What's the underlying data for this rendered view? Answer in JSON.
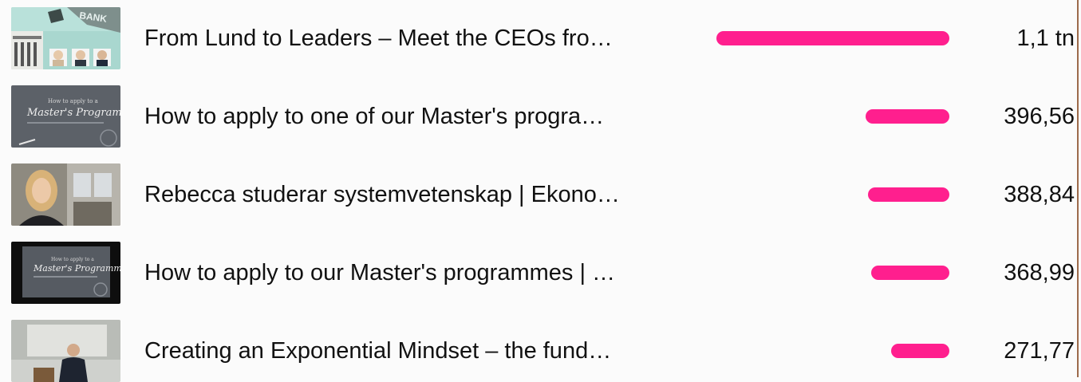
{
  "rows": [
    {
      "title": "From Lund to Leaders – Meet the CEOs fro…",
      "value": "1,1 tn",
      "fraction": 1.0,
      "thumbnail": "ceos-bank-thumbnail"
    },
    {
      "title": "How to apply to one of our Master's progra…",
      "value": "396,56",
      "fraction": 0.36,
      "thumbnail": "masters-programme-slide-thumbnail"
    },
    {
      "title": "Rebecca studerar systemvetenskap | Ekono…",
      "value": "388,84",
      "fraction": 0.35,
      "thumbnail": "student-portrait-thumbnail"
    },
    {
      "title": "How to apply to our Master's programmes | …",
      "value": "368,99",
      "fraction": 0.335,
      "thumbnail": "masters-programme-slide-dark-thumbnail"
    },
    {
      "title": "Creating an Exponential Mindset – the fund…",
      "value": "271,77",
      "fraction": 0.25,
      "thumbnail": "lecture-speaker-thumbnail"
    }
  ],
  "colors": {
    "bar": "#ff1f8e",
    "text": "#111111"
  }
}
